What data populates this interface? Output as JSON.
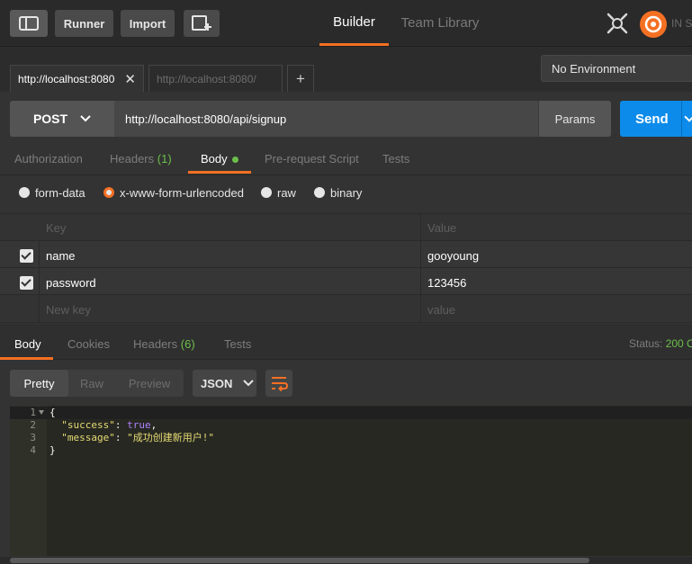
{
  "topbar": {
    "runner_label": "Runner",
    "import_label": "Import",
    "tabs": [
      {
        "label": "Builder"
      },
      {
        "label": "Team Library"
      }
    ],
    "sync_label": "IN S"
  },
  "request_tabs": [
    {
      "label": "http://localhost:8080",
      "close": "✕"
    },
    {
      "label": "http://localhost:8080/"
    }
  ],
  "add_tab": "+",
  "environment": "No Environment",
  "request": {
    "method": "POST",
    "url": "http://localhost:8080/api/signup",
    "params_label": "Params",
    "send_label": "Send"
  },
  "request_subtabs": {
    "authorization": "Authorization",
    "headers": "Headers",
    "headers_count": "(1)",
    "body": "Body",
    "prerequest": "Pre-request Script",
    "tests": "Tests"
  },
  "body_modes": [
    "form-data",
    "x-www-form-urlencoded",
    "raw",
    "binary"
  ],
  "kv_table": {
    "key_header": "Key",
    "value_header": "Value",
    "rows": [
      {
        "key": "name",
        "value": "gooyoung"
      },
      {
        "key": "password",
        "value": "123456"
      }
    ],
    "new_key_placeholder": "New key",
    "new_value_placeholder": "value"
  },
  "response_tabs": {
    "body": "Body",
    "cookies": "Cookies",
    "headers": "Headers",
    "headers_count": "(6)",
    "tests": "Tests"
  },
  "status": {
    "label": "Status:",
    "value": "200 O"
  },
  "response_view": {
    "pretty": "Pretty",
    "raw": "Raw",
    "preview": "Preview",
    "format": "JSON"
  },
  "response_code": {
    "line_numbers": [
      "1",
      "2",
      "3",
      "4"
    ],
    "open_brace": "{",
    "success_key": "\"success\"",
    "success_value": "true",
    "message_key": "\"message\"",
    "message_value": "\"成功创建新用户!\"",
    "close_brace": "}"
  },
  "colors": {
    "accent": "#f47023",
    "send": "#0c8bea",
    "success": "#6cc04a"
  }
}
